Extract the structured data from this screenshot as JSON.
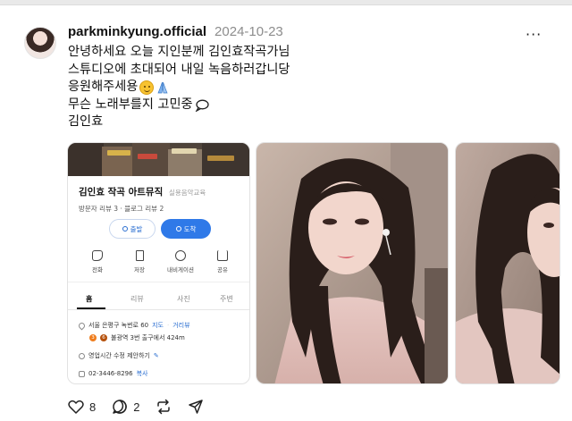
{
  "post": {
    "username": "parkminkyung.official",
    "date": "2024-10-23",
    "caption_lines": [
      "안녕하세요 오늘 지인분께 김인효작곡가님",
      "스튜디오에 초대되어 내일 녹음하러갑니당",
      "응원해주세용",
      "무슨 노래부를지 고민중",
      "김인효"
    ]
  },
  "map_card": {
    "title": "김인효 작곡 아트뮤직",
    "category": "실용음악교육",
    "reviews": "방문자 리뷰 3 · 블로그 리뷰 2",
    "start_label": "출발",
    "arrive_label": "도착",
    "actions": [
      "전화",
      "저장",
      "내비게이션",
      "공유"
    ],
    "tabs": [
      "홈",
      "리뷰",
      "사진",
      "주변"
    ],
    "address": "서울 은평구 녹번로 60",
    "map_link": "지도",
    "distance_link": "거리뷰",
    "subway": "불광역 3번 출구에서 424m",
    "subway_lines": [
      "3",
      "6"
    ],
    "hours": "영업시간 수정 제안하기",
    "phone": "02-3446-8296",
    "copy_label": "복사"
  },
  "footer": {
    "likes": "8",
    "comments": "2"
  },
  "colors": {
    "accent_blue": "#2f79e8",
    "line3_orange": "#ef7c1c",
    "line6_brown": "#b5500b"
  }
}
